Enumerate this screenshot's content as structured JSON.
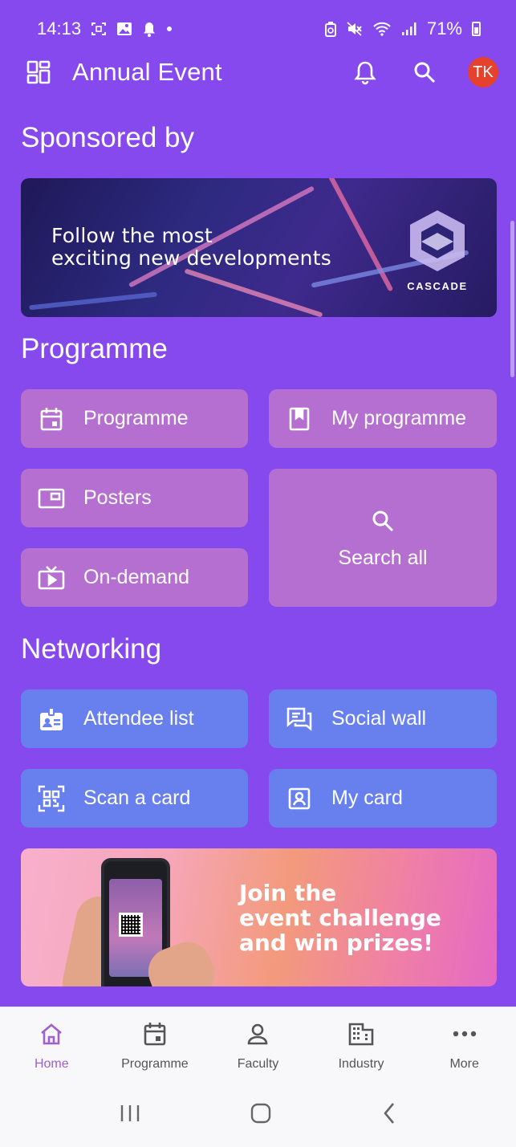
{
  "status_bar": {
    "time": "14:13",
    "battery": "71%"
  },
  "app_bar": {
    "title": "Annual Event",
    "avatar_initials": "TK"
  },
  "sections": {
    "sponsored": "Sponsored by",
    "programme": "Programme",
    "networking": "Networking"
  },
  "sponsor": {
    "text_line1": "Follow the most",
    "text_line2": "exciting new developments",
    "logo": "CASCADE"
  },
  "programme_tiles": {
    "programme": "Programme",
    "my_programme": "My programme",
    "posters": "Posters",
    "on_demand": "On-demand",
    "search_all": "Search all"
  },
  "networking_tiles": {
    "attendee_list": "Attendee list",
    "social_wall": "Social wall",
    "scan_card": "Scan a card",
    "my_card": "My card"
  },
  "challenge": {
    "line1": "Join the",
    "line2": "event challenge",
    "line3": "and win prizes!"
  },
  "bottom_nav": {
    "home": "Home",
    "programme": "Programme",
    "faculty": "Faculty",
    "industry": "Industry",
    "more": "More"
  },
  "colors": {
    "background": "#8549ee",
    "tile_purple": "#b56fd0",
    "tile_blue": "#6780ee",
    "avatar": "#e5412c",
    "nav_active": "#a05fc9"
  },
  "icons": {
    "app_menu": "dashboard-icon",
    "notifications": "bell-icon",
    "search": "search-icon"
  }
}
